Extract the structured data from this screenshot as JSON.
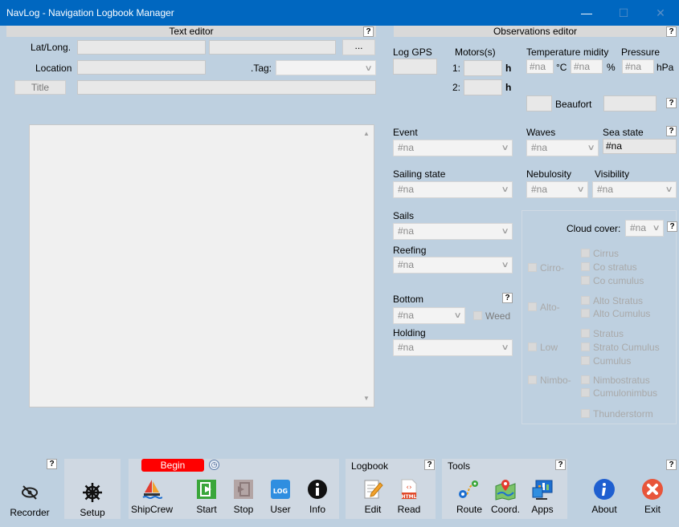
{
  "window": {
    "title": "NavLog - Navigation Logbook Manager",
    "min": "—",
    "max": "☐",
    "close": "✕"
  },
  "text_editor": {
    "header": "Text editor",
    "help": "?",
    "latlong_label": "Lat/Long.",
    "latlong_button": "...",
    "location_label": "Location",
    "tag_label": ".Tag:",
    "title_button": "Title"
  },
  "obs": {
    "header": "Observations editor",
    "help": "?",
    "log_gps": "Log GPS",
    "motors": "Motors(s)",
    "motor1": "1:",
    "motor2": "2:",
    "h": "h",
    "temperature": "Temperature",
    "humidity": "midity",
    "pressure": "Pressure",
    "temp_val": "#na",
    "temp_unit": "°C",
    "hum_val": "#na",
    "hum_unit": "%",
    "pres_val": "#na",
    "pres_unit": "hPa",
    "beaufort": "Beaufort",
    "event": "Event",
    "event_val": "#na",
    "waves": "Waves",
    "waves_val": "#na",
    "sea_state": "Sea state",
    "sea_state_val": "#na",
    "sailing_state": "Sailing state",
    "sailing_val": "#na",
    "nebulosity": "Nebulosity",
    "nebulosity_val": "#na",
    "visibility": "Visibility",
    "visibility_val": "#na",
    "sails": "Sails",
    "sails_val": "#na",
    "reefing": "Reefing",
    "reefing_val": "#na",
    "bottom": "Bottom",
    "bottom_val": "#na",
    "weed": "Weed",
    "holding": "Holding",
    "holding_val": "#na",
    "cloud_cover": "Cloud cover:",
    "cloud_cover_val": "#na",
    "cirro": "Cirro-",
    "cirrus": "Cirrus",
    "co_stratus": "Co stratus",
    "co_cumulus": "Co cumulus",
    "alto": "Alto-",
    "alto_stratus": "Alto Stratus",
    "alto_cumulus": "Alto Cumulus",
    "low": "Low",
    "stratus": "Stratus",
    "strato_cumulus": "Strato Cumulus",
    "cumulus": "Cumulus",
    "nimbo": "Nimbo-",
    "nimbostratus": "Nimbostratus",
    "cumulonimbus": "Cumulonimbus",
    "thunderstorm": "Thunderstorm"
  },
  "toolbar": {
    "help": "?",
    "recorder": "Recorder",
    "setup": "Setup",
    "begin": "Begin",
    "shipcrew": "ShipCrew",
    "start": "Start",
    "stop": "Stop",
    "user": "User",
    "info": "Info",
    "logbook": "Logbook",
    "edit": "Edit",
    "read": "Read",
    "tools": "Tools",
    "route": "Route",
    "coord": "Coord.",
    "apps": "Apps",
    "about": "About",
    "exit": "Exit",
    "log_icon_text": "LOG",
    "html_icon_text": "HTML"
  },
  "colors": {
    "titlebar": "#0067c0",
    "background": "#bed0e0",
    "begin": "#ff0000",
    "about": "#1f5fd0",
    "exit": "#e8553a"
  }
}
